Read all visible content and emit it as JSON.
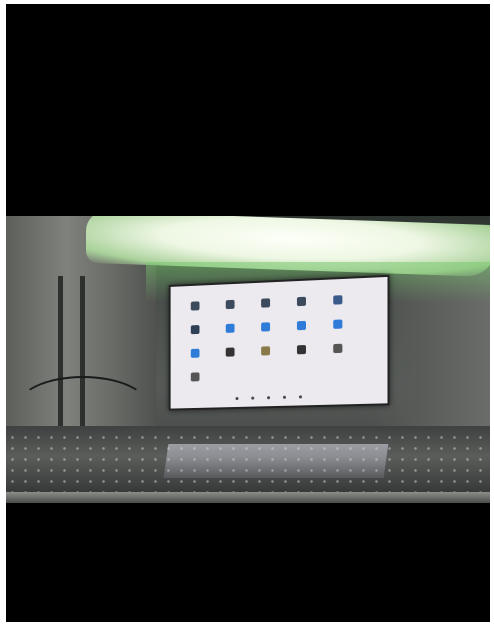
{
  "scene": {
    "description_kind": "photo",
    "colors": {
      "light": "#fdfff8",
      "glow": "#a9d19a",
      "tablet_screen": "#ece9ef"
    }
  },
  "tablet": {
    "apps": [
      {
        "icon": "app-icon",
        "color": "#3b4a5c"
      },
      {
        "icon": "app-icon",
        "color": "#3b4a5c"
      },
      {
        "icon": "app-icon",
        "color": "#3b4a5c"
      },
      {
        "icon": "app-icon",
        "color": "#3b4a5c"
      },
      {
        "icon": "gear-icon",
        "color": "#3a5a8c"
      },
      {
        "icon": "app-icon",
        "color": "#2f3f55"
      },
      {
        "icon": "app-icon",
        "color": "#2e7bd8"
      },
      {
        "icon": "app-icon",
        "color": "#2e7bd8"
      },
      {
        "icon": "app-icon",
        "color": "#2e7bd8"
      },
      {
        "icon": "folder-icon",
        "color": "#2e7bd8"
      },
      {
        "icon": "app-icon",
        "color": "#2e7bd8"
      },
      {
        "icon": "app-icon",
        "color": "#333333"
      },
      {
        "icon": "app-icon",
        "color": "#8a7a4a"
      },
      {
        "icon": "app-icon",
        "color": "#333333"
      },
      {
        "icon": "search-icon",
        "color": "#555555"
      },
      {
        "icon": "location-icon",
        "color": "#555555"
      }
    ]
  }
}
